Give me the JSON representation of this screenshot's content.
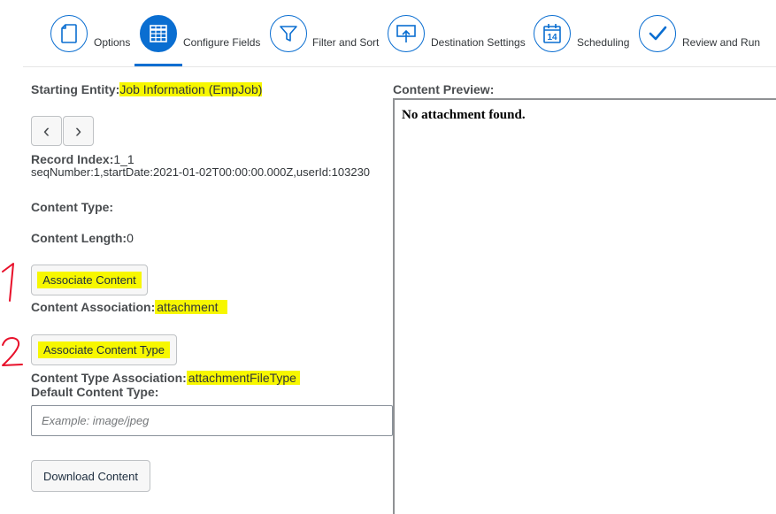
{
  "wizard": {
    "steps": [
      {
        "label": "Options",
        "icon": "document-icon",
        "active": false
      },
      {
        "label": "Configure Fields",
        "icon": "table-icon",
        "active": true
      },
      {
        "label": "Filter and Sort",
        "icon": "filter-icon",
        "active": false
      },
      {
        "label": "Destination Settings",
        "icon": "upload-icon",
        "active": false
      },
      {
        "label": "Scheduling",
        "icon": "calendar-icon",
        "active": false
      },
      {
        "label": "Review and Run",
        "icon": "checkmark-icon",
        "active": false
      }
    ],
    "calendar_day": "14"
  },
  "form": {
    "starting_entity_label": "Starting Entity:",
    "starting_entity_value": "Job Information (EmpJob)",
    "prev_icon": "‹",
    "next_icon": "›",
    "record_index_label": "Record Index:",
    "record_index_value": "1_1",
    "record_key": "seqNumber:1,startDate:2021-01-02T00:00:00.000Z,userId:103230",
    "content_type_label": "Content Type:",
    "content_length_label": "Content Length:",
    "content_length_value": "0",
    "associate_content_button": "Associate Content",
    "content_association_label": "Content Association:",
    "content_association_value": "attachment",
    "associate_content_type_button": "Associate Content Type",
    "content_type_association_label": "Content Type Association:",
    "content_type_association_value": "attachmentFileType",
    "default_content_type_label": "Default Content Type:",
    "default_content_type_placeholder": "Example: image/jpeg",
    "default_content_type_value": "",
    "download_content_button": "Download Content"
  },
  "preview": {
    "label": "Content Preview:",
    "text": "No attachment found."
  },
  "annotations": {
    "number_1": "1",
    "number_2": "2",
    "highlight_color": "#f7f700",
    "annotation_color": "#e8102a"
  },
  "colors": {
    "accent": "#0a6ed1"
  }
}
